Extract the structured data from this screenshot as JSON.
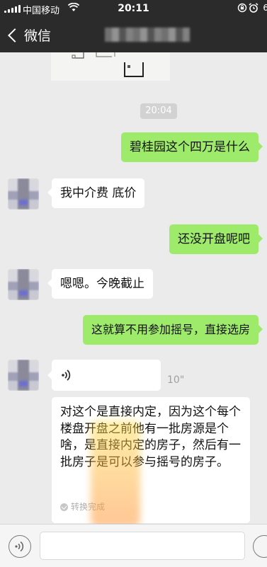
{
  "status_bar": {
    "carrier": "中国移动",
    "time": "20:11",
    "battery_level_text": "6"
  },
  "nav": {
    "back_label": "微信"
  },
  "chat": {
    "timestamp": "20:04",
    "messages": [
      {
        "from": "me",
        "text": "碧桂园这个四万是什么"
      },
      {
        "from": "other",
        "text": "我中介费 底价"
      },
      {
        "from": "me",
        "text": "还没开盘呢吧"
      },
      {
        "from": "other",
        "text": "嗯嗯。今晚截止"
      },
      {
        "from": "me",
        "text": "这就算不用参加摇号，直接选房"
      }
    ],
    "voice_message": {
      "duration": "10\"",
      "transcript": "对这个是直接内定，因为这个每个楼盘开盘之前他有一批房源是个啥，是直接内定的房子，然后有一批房子是可以参与摇号的房子。",
      "transcript_status": "转换完成"
    }
  },
  "colors": {
    "bar_bg": "#2b2b2b",
    "chat_bg": "#ebebeb",
    "outgoing_bubble": "#9eea6a",
    "incoming_bubble": "#ffffff"
  },
  "icons": [
    "signal-icon",
    "wifi-icon",
    "lock-rotation-icon",
    "alarm-icon",
    "back-chevron-icon",
    "voice-wave-icon",
    "voice-input-icon",
    "emoji-icon",
    "check-icon"
  ]
}
